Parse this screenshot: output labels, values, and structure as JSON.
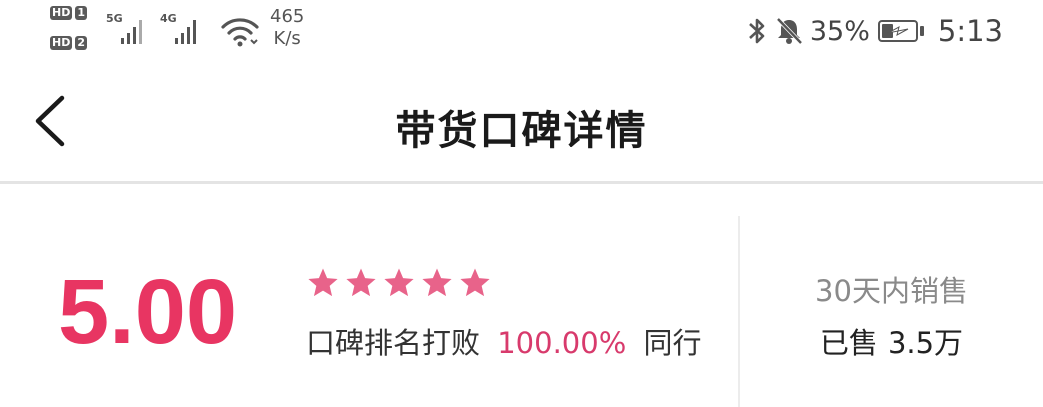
{
  "status_bar": {
    "sim_labels": [
      "HD",
      "HD"
    ],
    "sim_numbers": [
      "1",
      "2"
    ],
    "networks": [
      "5G",
      "4G"
    ],
    "speed_value": "465",
    "speed_unit": "K/s",
    "battery_percent": "35%",
    "battery_level": 0.35,
    "time": "5:13",
    "icons": [
      "bluetooth-icon",
      "mute-bell-icon",
      "battery-charging-icon",
      "wifi-icon",
      "signal-icon"
    ]
  },
  "nav": {
    "title": "带货口碑详情",
    "back_icon": "chevron-left-icon"
  },
  "summary": {
    "score": "5.00",
    "stars": 5,
    "rank_prefix": "口碑排名打败",
    "rank_percent": "100.00%",
    "rank_suffix": "同行",
    "sales_label": "30天内销售",
    "sales_prefix": "已售",
    "sales_value": "3.5万"
  },
  "colors": {
    "accent": "#e83562",
    "star": "#e8638a",
    "percent": "#d83a6c"
  }
}
